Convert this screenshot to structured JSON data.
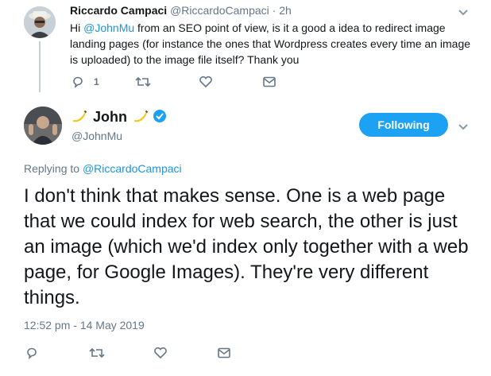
{
  "parent_tweet": {
    "display_name": "Riccardo Campaci",
    "handle": "@RiccardoCampaci",
    "separator": "·",
    "time": "2h",
    "text_prefix": "Hi ",
    "mention": "@JohnMu",
    "text_rest": " from an SEO point of view, is it a good a idea to redirect image landing pages (for instance the ones that Wordpress creates every time an image is uploaded) to the image file itself? Thank you",
    "reply_count": "1",
    "icons": [
      "reply-icon",
      "retweet-icon",
      "like-icon",
      "dm-icon"
    ]
  },
  "main_tweet": {
    "display_name": "John",
    "name_emoji": "banana",
    "handle": "@JohnMu",
    "follow_label": "Following",
    "replying_prefix": "Replying to ",
    "replying_to": "@RiccardoCampaci",
    "text": "I don't think that makes sense. One is a web page that we could index for web search, the other is just an image (which we'd index only together with a web page, for Google Images). They're very different things.",
    "timestamp": "12:52 pm - 14 May 2019",
    "icons": [
      "reply-icon",
      "retweet-icon",
      "like-icon",
      "dm-icon"
    ]
  },
  "colors": {
    "accent": "#1da1f2",
    "link": "#1b95e0",
    "muted": "#657786",
    "text": "#14171a",
    "thread_line": "#c4cfd6"
  }
}
